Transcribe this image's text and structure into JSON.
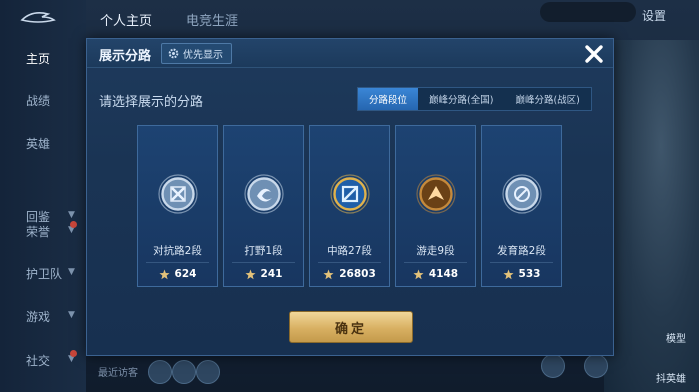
{
  "background": {
    "top_nav": {
      "home_tab": "个人主页",
      "career_tab": "电竞生涯"
    },
    "settings_label": "设置",
    "sidebar": [
      {
        "label": "主页",
        "active": true,
        "chevron": false,
        "dot": false
      },
      {
        "label": "战绩",
        "active": false,
        "chevron": false,
        "dot": false
      },
      {
        "label": "英雄",
        "active": false,
        "chevron": false,
        "dot": false
      },
      {
        "label": "回鉴",
        "active": false,
        "chevron": true,
        "dot": false
      },
      {
        "label": "荣誉",
        "active": false,
        "chevron": true,
        "dot": true
      },
      {
        "label": "护卫队",
        "active": false,
        "chevron": true,
        "dot": false
      },
      {
        "label": "游戏",
        "active": false,
        "chevron": true,
        "dot": false
      },
      {
        "label": "社交",
        "active": false,
        "chevron": true,
        "dot": true
      }
    ],
    "recent_visitors_label": "最近访客",
    "corner_labels": {
      "model": "模型",
      "draw": "抖英雄"
    }
  },
  "dialog": {
    "title": "展示分路",
    "priority_label": "优先显示",
    "subtitle": "请选择展示的分路",
    "tabs": [
      {
        "label": "分路段位",
        "active": true
      },
      {
        "label": "巅峰分路(全国)",
        "active": false
      },
      {
        "label": "巅峰分路(战区)",
        "active": false
      }
    ],
    "cards": [
      {
        "name": "对抗路2段",
        "points": "624",
        "badge": "clash-lane-badge-icon",
        "tier": "silver"
      },
      {
        "name": "打野1段",
        "points": "241",
        "badge": "jungle-badge-icon",
        "tier": "silver"
      },
      {
        "name": "中路27段",
        "points": "26803",
        "badge": "mid-lane-badge-icon",
        "tier": "gold"
      },
      {
        "name": "游走9段",
        "points": "4148",
        "badge": "roam-badge-icon",
        "tier": "bronze"
      },
      {
        "name": "发育路2段",
        "points": "533",
        "badge": "farm-lane-badge-icon",
        "tier": "silver"
      }
    ],
    "confirm_label": "确定"
  },
  "colors": {
    "accent_blue": "#2f77c8",
    "confirm_gold": "#d8b062",
    "panel": "#1a3454"
  }
}
